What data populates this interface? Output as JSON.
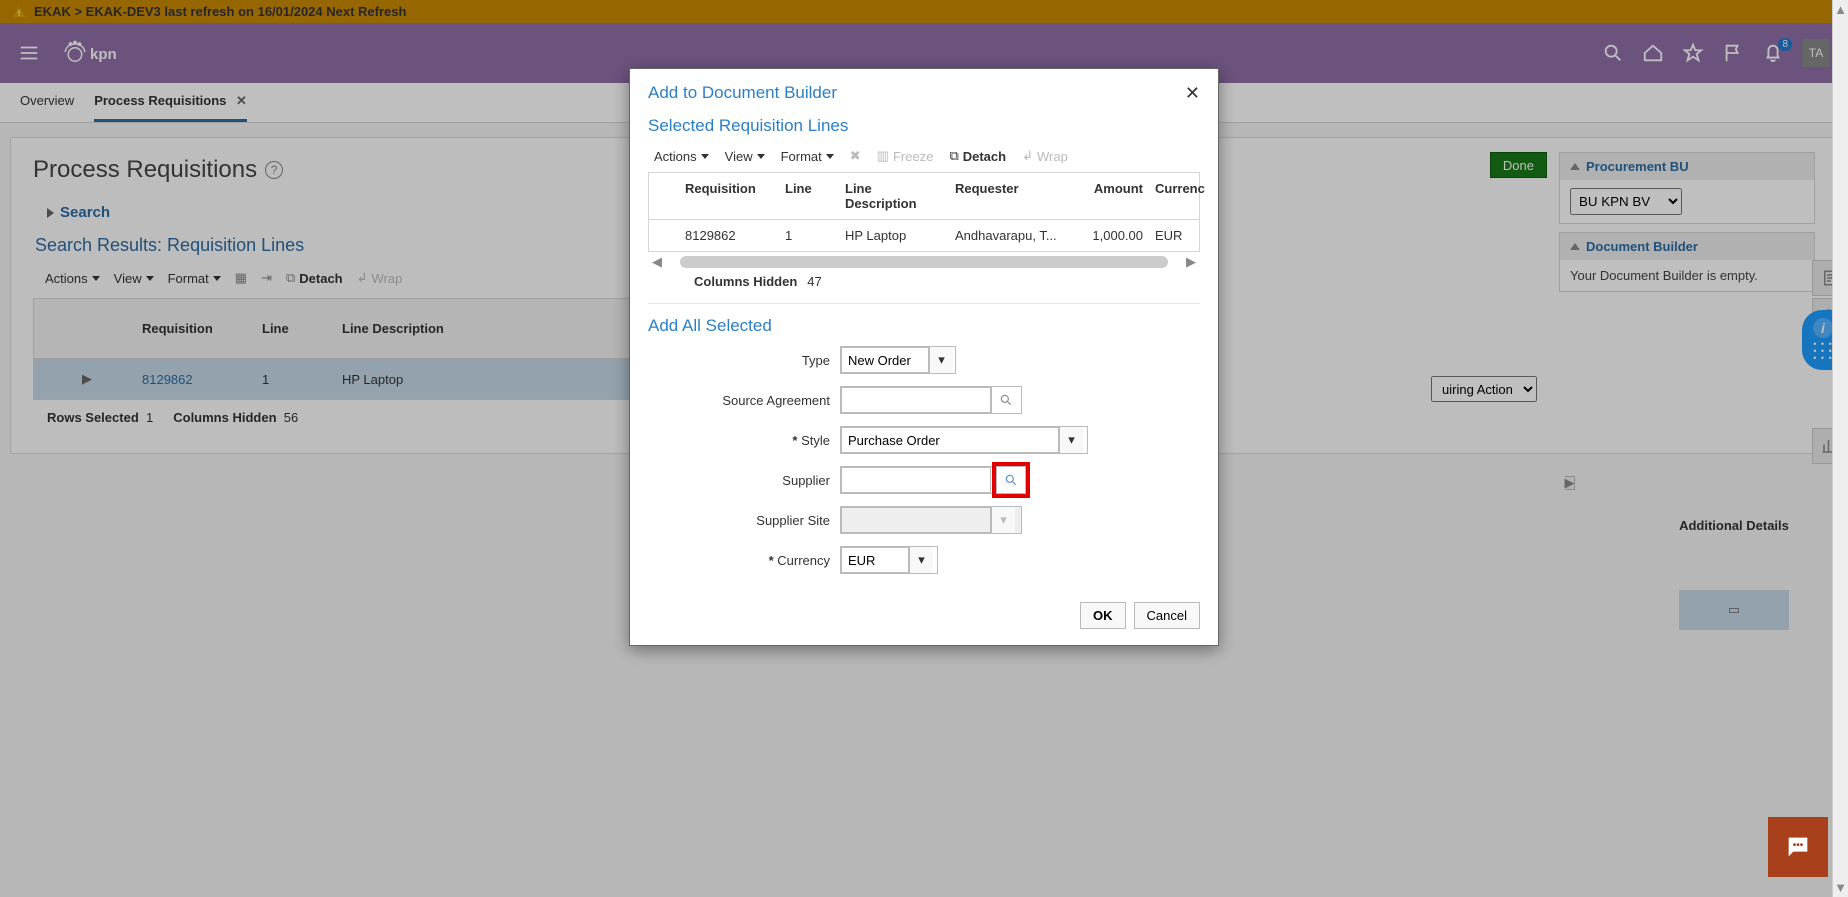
{
  "warning": {
    "text": "EKAK > EKAK-DEV3 last refresh on 16/01/2024 Next Refresh"
  },
  "header": {
    "logo_text": "kpn",
    "notif_count": "8",
    "avatar": "TA"
  },
  "tabs": {
    "overview": "Overview",
    "process": "Process Requisitions"
  },
  "page": {
    "title": "Process Requisitions",
    "search": "Search",
    "results_title": "Search Results: Requisition Lines",
    "toolbar": {
      "actions": "Actions",
      "view": "View",
      "format": "Format",
      "detach": "Detach",
      "wrap": "Wrap"
    },
    "grid": {
      "headers": {
        "req": "Requisition",
        "line": "Line",
        "desc": "Line Description",
        "add": "Additional Details"
      },
      "row": {
        "req": "8129862",
        "line": "1",
        "desc": "HP Laptop"
      }
    },
    "footer": {
      "rows_sel_label": "Rows Selected",
      "rows_sel": "1",
      "cols_hidden_label": "Columns Hidden",
      "cols_hidden": "56"
    },
    "done": "Done",
    "requiring": "uiring Action",
    "right": {
      "procurement_bu": {
        "title": "Procurement BU",
        "value": "BU KPN BV"
      },
      "doc_builder": {
        "title": "Document Builder",
        "empty": "Your Document Builder is empty."
      }
    }
  },
  "dialog": {
    "title": "Add to Document Builder",
    "sub1": "Selected Requisition Lines",
    "toolbar": {
      "actions": "Actions",
      "view": "View",
      "format": "Format",
      "freeze": "Freeze",
      "detach": "Detach",
      "wrap": "Wrap"
    },
    "table": {
      "headers": {
        "req": "Requisition",
        "line": "Line",
        "desc": "Line Description",
        "requester": "Requester",
        "amount": "Amount",
        "currency": "Currenc"
      },
      "row": {
        "req": "8129862",
        "line": "1",
        "desc": "HP Laptop",
        "requester": "Andhavarapu, T...",
        "amount": "1,000.00",
        "currency": "EUR"
      }
    },
    "cols_hidden_label": "Columns Hidden",
    "cols_hidden": "47",
    "sub2": "Add All Selected",
    "form": {
      "type": {
        "label": "Type",
        "value": "New Order"
      },
      "source_agreement": {
        "label": "Source Agreement",
        "value": ""
      },
      "style": {
        "label": "Style",
        "value": "Purchase Order"
      },
      "supplier": {
        "label": "Supplier",
        "value": ""
      },
      "supplier_site": {
        "label": "Supplier Site",
        "value": ""
      },
      "currency": {
        "label": "Currency",
        "value": "EUR"
      }
    },
    "ok": "OK",
    "cancel": "Cancel"
  }
}
